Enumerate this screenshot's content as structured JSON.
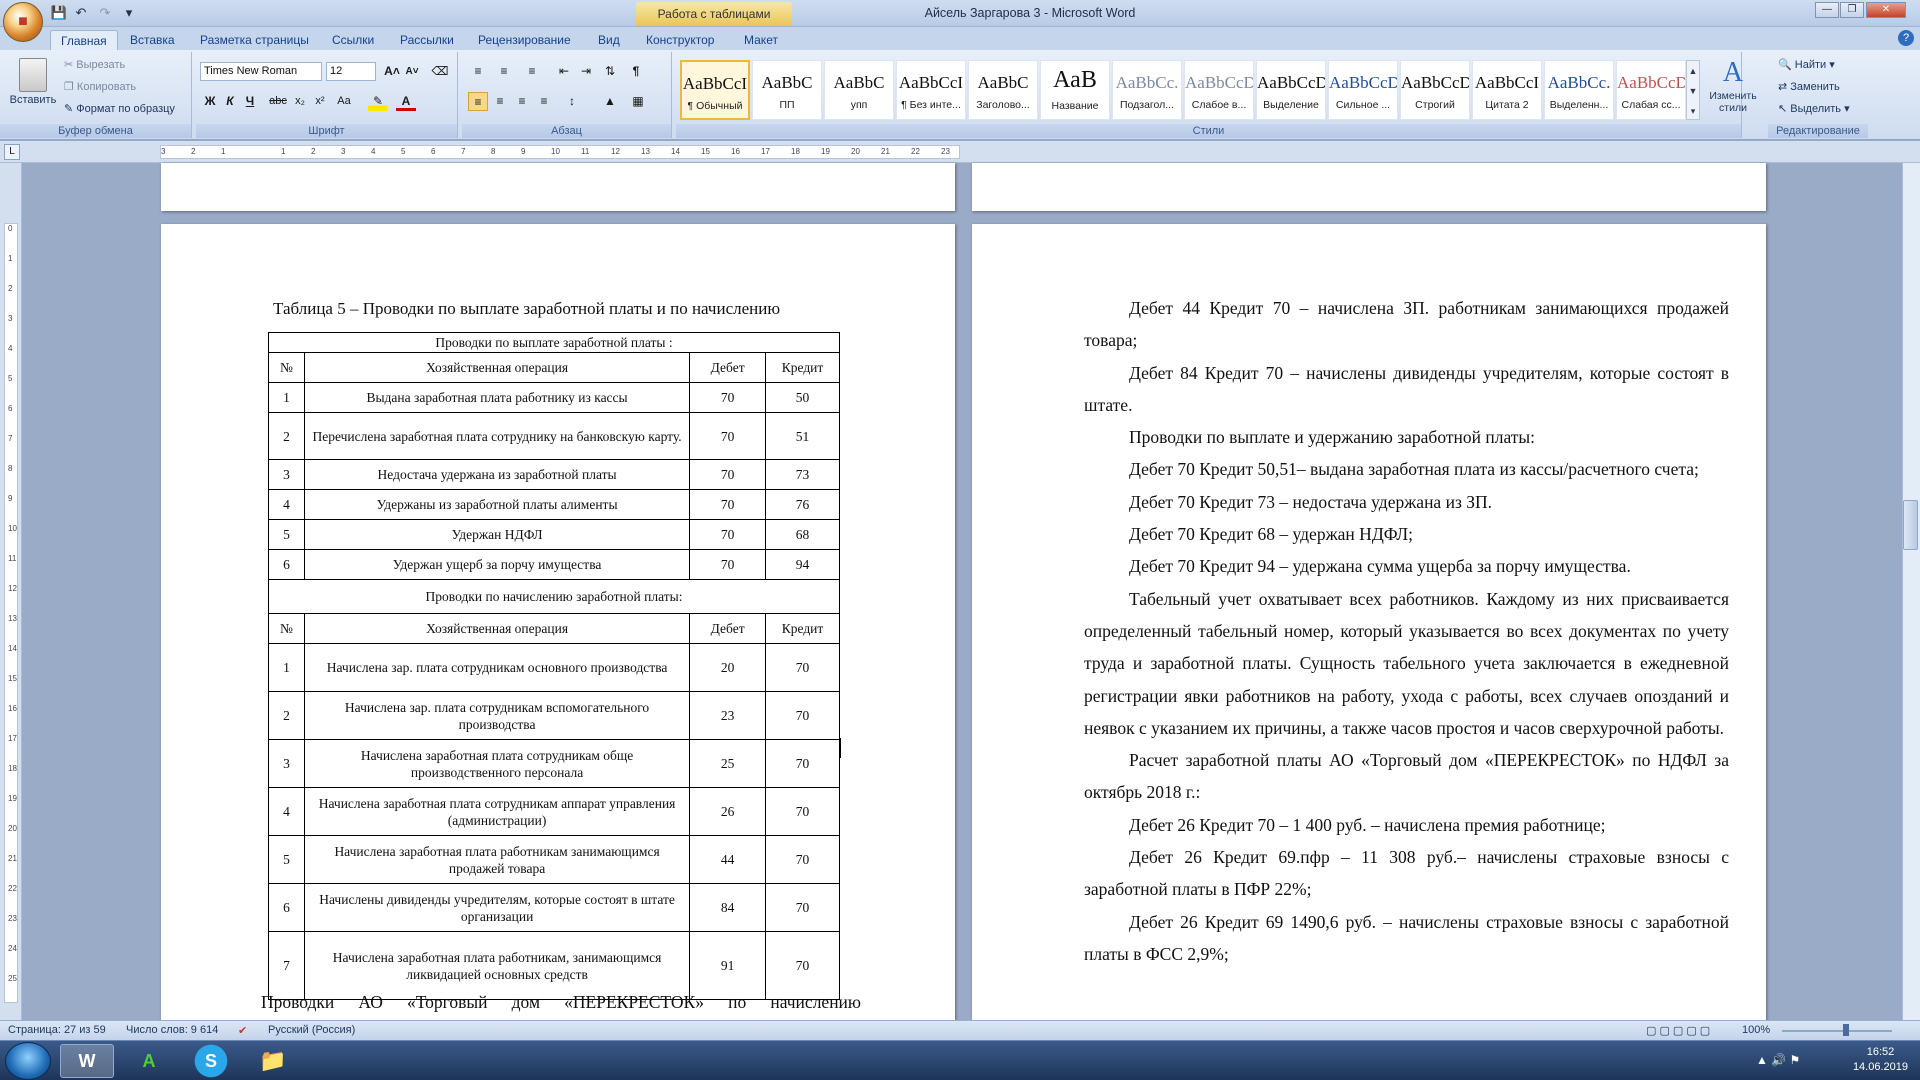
{
  "window": {
    "title": "Айсель Заргарова 3 - Microsoft Word",
    "context_tab": "Работа с таблицами"
  },
  "tabs": [
    "Главная",
    "Вставка",
    "Разметка страницы",
    "Ссылки",
    "Рассылки",
    "Рецензирование",
    "Вид",
    "Конструктор",
    "Макет"
  ],
  "clipboard": {
    "paste": "Вставить",
    "cut": "Вырезать",
    "copy": "Копировать",
    "format_painter": "Формат по образцу",
    "label": "Буфер обмена"
  },
  "font": {
    "name": "Times New Roman",
    "size": "12",
    "label": "Шрифт"
  },
  "paragraph": {
    "label": "Абзац"
  },
  "styles": {
    "label": "Стили",
    "items": [
      {
        "sample": "AaBbCcI",
        "name": "¶ Обычный"
      },
      {
        "sample": "AaBbC",
        "name": "ПП"
      },
      {
        "sample": "AaBbC",
        "name": "упп"
      },
      {
        "sample": "AaBbCcI",
        "name": "¶ Без инте..."
      },
      {
        "sample": "AaBbC",
        "name": "Заголово..."
      },
      {
        "sample": "АаВ",
        "name": "Название"
      },
      {
        "sample": "AaBbCc.",
        "name": "Подзагол..."
      },
      {
        "sample": "AaBbCcD",
        "name": "Слабое в..."
      },
      {
        "sample": "AaBbCcD",
        "name": "Выделение"
      },
      {
        "sample": "AaBbCcD",
        "name": "Сильное ..."
      },
      {
        "sample": "AaBbCcD",
        "name": "Строгий"
      },
      {
        "sample": "AaBbCcI",
        "name": "Цитата 2"
      },
      {
        "sample": "AaBbCc.",
        "name": "Выделенн..."
      },
      {
        "sample": "AaBbCcD",
        "name": "Слабая сс..."
      }
    ],
    "change_styles": "Изменить стили"
  },
  "editing": {
    "find": "Найти",
    "replace": "Заменить",
    "select": "Выделить",
    "label": "Редактирование"
  },
  "doc": {
    "table_caption": "Таблица 5 – Проводки по выплате заработной платы и по начислению",
    "section1_title": "Проводки по выплате заработной платы :",
    "section2_title": "Проводки по начислению заработной платы:",
    "headers": {
      "num": "№",
      "op": "Хозяйственная операция",
      "debit": "Дебет",
      "credit": "Кредит"
    },
    "rows1": [
      {
        "n": "1",
        "op": "Выдана заработная плата работнику из кассы",
        "d": "70",
        "c": "50"
      },
      {
        "n": "2",
        "op": "Перечислена заработная плата сотруднику на банковскую карту.",
        "d": "70",
        "c": "51"
      },
      {
        "n": "3",
        "op": "Недостача удержана из заработной платы",
        "d": "70",
        "c": "73"
      },
      {
        "n": "4",
        "op": "Удержаны из заработной платы алименты",
        "d": "70",
        "c": "76"
      },
      {
        "n": "5",
        "op": "Удержан НДФЛ",
        "d": "70",
        "c": "68"
      },
      {
        "n": "6",
        "op": "Удержан ущерб за порчу имущества",
        "d": "70",
        "c": "94"
      }
    ],
    "rows2": [
      {
        "n": "1",
        "op": "Начислена зар. плата сотрудникам основного производства",
        "d": "20",
        "c": "70"
      },
      {
        "n": "2",
        "op": "Начислена зар. плата сотрудникам вспомогательного производства",
        "d": "23",
        "c": "70"
      },
      {
        "n": "3",
        "op": "Начислена заработная плата сотрудникам обще производственного персонала",
        "d": "25",
        "c": "70"
      },
      {
        "n": "4",
        "op": "Начислена заработная плата сотрудникам аппарат управления (администрации)",
        "d": "26",
        "c": "70"
      },
      {
        "n": "5",
        "op": "Начислена заработная плата работникам занимающимся продажей товара",
        "d": "44",
        "c": "70"
      },
      {
        "n": "6",
        "op": "Начислены дивиденды учредителям, которые состоят в штате организации",
        "d": "84",
        "c": "70"
      },
      {
        "n": "7",
        "op": "Начислена заработная плата работникам, занимающимся ликвидацией основных средств",
        "d": "91",
        "c": "70"
      }
    ],
    "bottom_line": "Проводки АО «Торговый дом «ПЕРЕКРЕСТОК» по начислению",
    "right_paragraphs": [
      "Дебет 44 Кредит 70 – начислена ЗП. работникам занимающихся продажей товара;",
      "Дебет 84 Кредит 70 – начислены дивиденды учредителям, которые состоят в штате.",
      "Проводки по выплате и удержанию заработной платы:",
      "Дебет 70 Кредит 50,51– выдана заработная плата из кассы/расчетного счета;",
      "Дебет 70 Кредит 73 – недостача удержана из ЗП.",
      "Дебет 70 Кредит 68 – удержан НДФЛ;",
      "Дебет 70 Кредит 94 – удержана сумма ущерба за порчу имущества.",
      "Табельный учет охватывает всех работников. Каждому из них присваивается определенный табельный номер, который указывается во всех документах по учету труда и заработной платы. Сущность табельного учета заключается в ежедневной регистрации явки работников на работу, ухода с работы, всех случаев опозданий и неявок с указанием их причины, а также часов простоя и часов сверхурочной работы.",
      "Расчет заработной платы АО «Торговый дом «ПЕРЕКРЕСТОК» по НДФЛ за октябрь 2018 г.:",
      "Дебет 26 Кредит 70 – 1 400 руб. – начислена премия работнице;",
      "Дебет 26 Кредит 69.пфр – 11 308 руб.– начислены страховые взносы с заработной платы в ПФР 22%;",
      "Дебет 26 Кредит 69 1490,6 руб. – начислены страховые взносы с заработной платы в ФСС 2,9%;"
    ]
  },
  "status": {
    "page": "Страница: 27 из 59",
    "words": "Число слов: 9 614",
    "lang": "Русский (Россия)",
    "zoom": "100%"
  },
  "taskbar": {
    "time": "16:52",
    "date": "14.06.2019"
  }
}
